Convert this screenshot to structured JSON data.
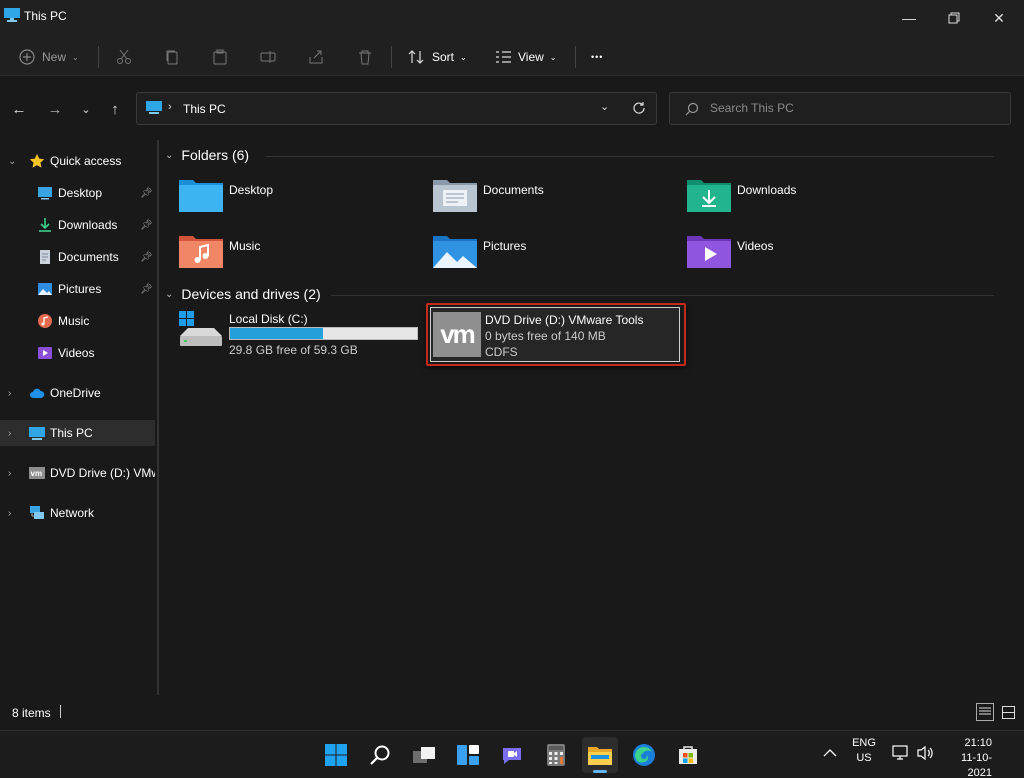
{
  "window": {
    "title": "This PC"
  },
  "toolbar": {
    "new_label": "New",
    "sort_label": "Sort",
    "view_label": "View",
    "more_label": "•••"
  },
  "address": {
    "path": "This PC"
  },
  "search": {
    "placeholder": "Search This PC"
  },
  "sidebar": {
    "quick_access": "Quick access",
    "items": [
      {
        "label": "Desktop"
      },
      {
        "label": "Downloads"
      },
      {
        "label": "Documents"
      },
      {
        "label": "Pictures"
      },
      {
        "label": "Music"
      },
      {
        "label": "Videos"
      }
    ],
    "onedrive": "OneDrive",
    "this_pc": "This PC",
    "dvd": "DVD Drive (D:) VMw",
    "network": "Network"
  },
  "content": {
    "folders_header": "Folders (6)",
    "folders": [
      {
        "label": "Desktop"
      },
      {
        "label": "Documents"
      },
      {
        "label": "Downloads"
      },
      {
        "label": "Music"
      },
      {
        "label": "Pictures"
      },
      {
        "label": "Videos"
      }
    ],
    "devices_header": "Devices and drives (2)",
    "local_disk": {
      "name": "Local Disk (C:)",
      "free": "29.8 GB free of 59.3 GB",
      "used_fraction": 0.497
    },
    "dvd_drive": {
      "name": "DVD Drive (D:) VMware Tools",
      "free": "0 bytes free of 140 MB",
      "fs": "CDFS",
      "logo": "vm"
    }
  },
  "status": {
    "items": "8 items"
  },
  "taskbar": {
    "lang1": "ENG",
    "lang2": "US",
    "time": "21:10",
    "date": "11-10-2021"
  },
  "colors": {
    "accent": "#0078d4",
    "selection_border": "#c42b1c",
    "progress": "#26a0da"
  }
}
